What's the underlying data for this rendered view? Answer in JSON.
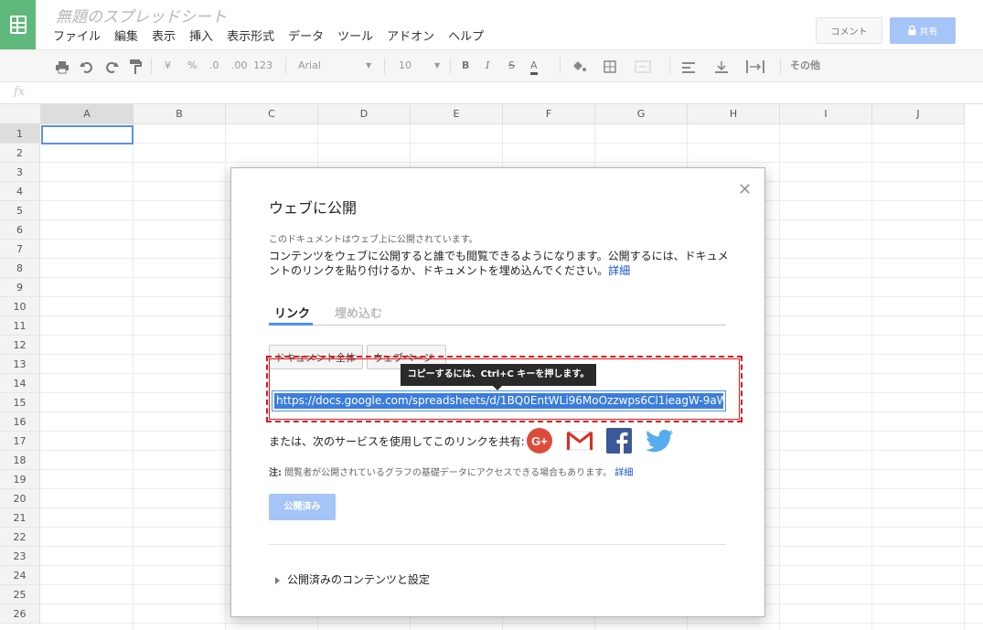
{
  "app": {
    "doc_title": "無題のスプレッドシート",
    "menu": [
      "ファイル",
      "編集",
      "表示",
      "挿入",
      "表示形式",
      "データ",
      "ツール",
      "アドオン",
      "ヘルプ"
    ],
    "comment_label": "コメント",
    "share_label": "共有",
    "brand_color": "#5fb97d",
    "accent_color": "#a5c4f7"
  },
  "toolbar": {
    "currency": "¥",
    "percent": "%",
    "dec_less": ".0",
    "dec_more": ".00",
    "number_format": "123",
    "font": "Arial",
    "font_size": "10",
    "bold": "B",
    "italic": "I",
    "strike": "S",
    "text_color": "A",
    "more": "その他"
  },
  "formula_bar": {
    "fx": "fx"
  },
  "grid": {
    "columns": [
      "A",
      "B",
      "C",
      "D",
      "E",
      "F",
      "G",
      "H",
      "I",
      "J"
    ],
    "rows": [
      "1",
      "2",
      "3",
      "4",
      "5",
      "6",
      "7",
      "8",
      "9",
      "10",
      "11",
      "12",
      "13",
      "14",
      "15",
      "16",
      "17",
      "18",
      "19",
      "20",
      "21",
      "22",
      "23",
      "24",
      "25",
      "26"
    ]
  },
  "dialog": {
    "title": "ウェブに公開",
    "status": "このドキュメントはウェブ上に公開されています。",
    "description": "コンテンツをウェブに公開すると誰でも閲覧できるようになります。公開するには、ドキュメントのリンクを貼り付けるか、ドキュメントを埋め込んでください。",
    "more_link": "詳細",
    "tabs": {
      "link": "リンク",
      "embed": "埋め込む"
    },
    "dropdown1": "ドキュメント全体",
    "dropdown2": "ウェブページ",
    "tooltip": "コピーするには、Ctrl+C キーを押します。",
    "url": "https://docs.google.com/spreadsheets/d/1BQ0EntWLi96MoOzzwps6Cl1ieagW-9aW",
    "share_text": "または、次のサービスを使用してこのリンクを共有:",
    "note_label": "注:",
    "note_text": "閲覧者が公開されているグラフの基礎データにアクセスできる場合もあります。",
    "note_more": "詳細",
    "published_button": "公開済み",
    "published_settings": "公開済みのコンテンツと設定",
    "highlight_color": "#d9161c"
  }
}
